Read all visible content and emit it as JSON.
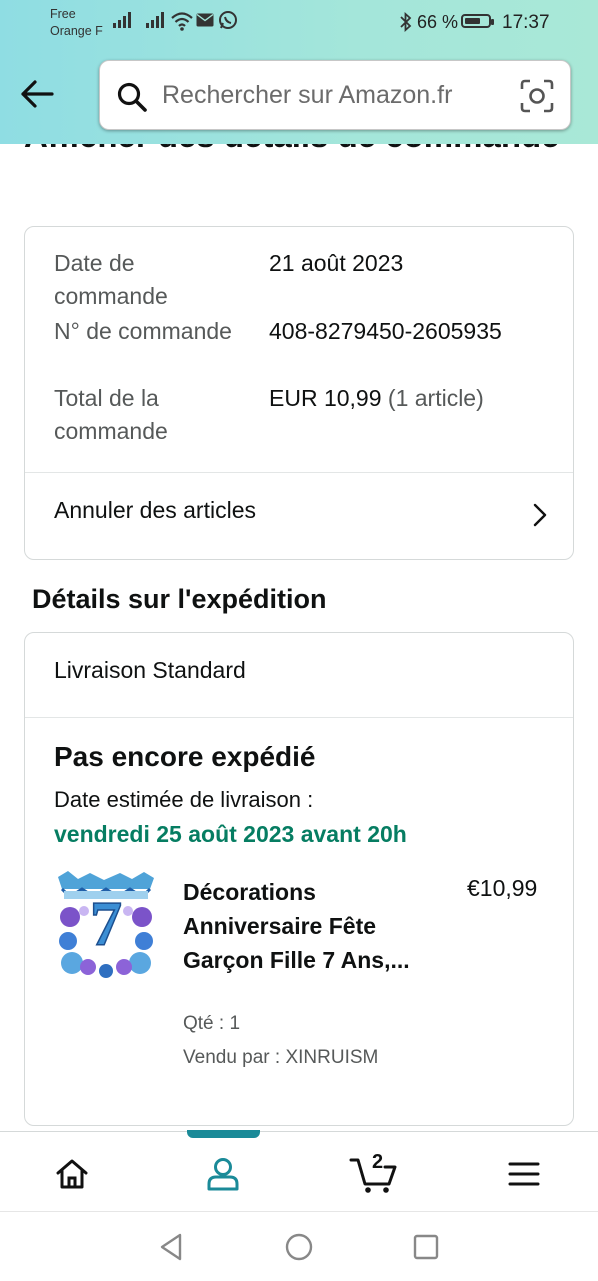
{
  "status_bar": {
    "carrier_1": "Free",
    "carrier_2": "Orange F",
    "battery_pct": "66 %",
    "battery_level": 0.66,
    "time": "17:37",
    "icons": [
      "signal-icon",
      "signal-icon",
      "wifi-icon",
      "mail-icon",
      "whatsapp-icon",
      "bluetooth-icon",
      "battery-icon"
    ]
  },
  "header": {
    "back_icon": "arrow-left-icon",
    "search_placeholder": "Rechercher sur Amazon.fr",
    "search_value": "",
    "camera_icon": "camera-scan-icon"
  },
  "page": {
    "title": "Afficher des détails de commande"
  },
  "order_summary": {
    "date_label": "Date de commande",
    "date_value": "21 août 2023",
    "number_label": "N° de commande",
    "number_value": "408-8279450-2605935",
    "total_label": "Total de la commande",
    "total_value": "EUR 10,99",
    "total_count": "(1 article)",
    "cancel_label": "Annuler des articles"
  },
  "shipment": {
    "section_title": "Détails sur l'expédition",
    "method": "Livraison Standard",
    "status": "Pas encore expédié",
    "eta_label": "Date estimée de livraison :",
    "eta_date": "vendredi 25 août 2023 avant 20h",
    "item": {
      "title": "Décorations Anniversaire Fête Garçon Fille 7 Ans,...",
      "price": "€10,99",
      "qty": "Qté : 1",
      "seller": "Vendu par : XINRUISM"
    }
  },
  "bottom_nav": {
    "items": [
      "home-icon",
      "account-icon",
      "cart-icon",
      "menu-icon"
    ],
    "active": "account-icon",
    "cart_count": "2"
  },
  "colors": {
    "header_gradient_start": "#8fdde3",
    "header_gradient_end": "#a9e8d7",
    "accent": "#1a8a98",
    "delivery_green": "#067d62",
    "text": "#0f1111",
    "muted": "#565959"
  }
}
